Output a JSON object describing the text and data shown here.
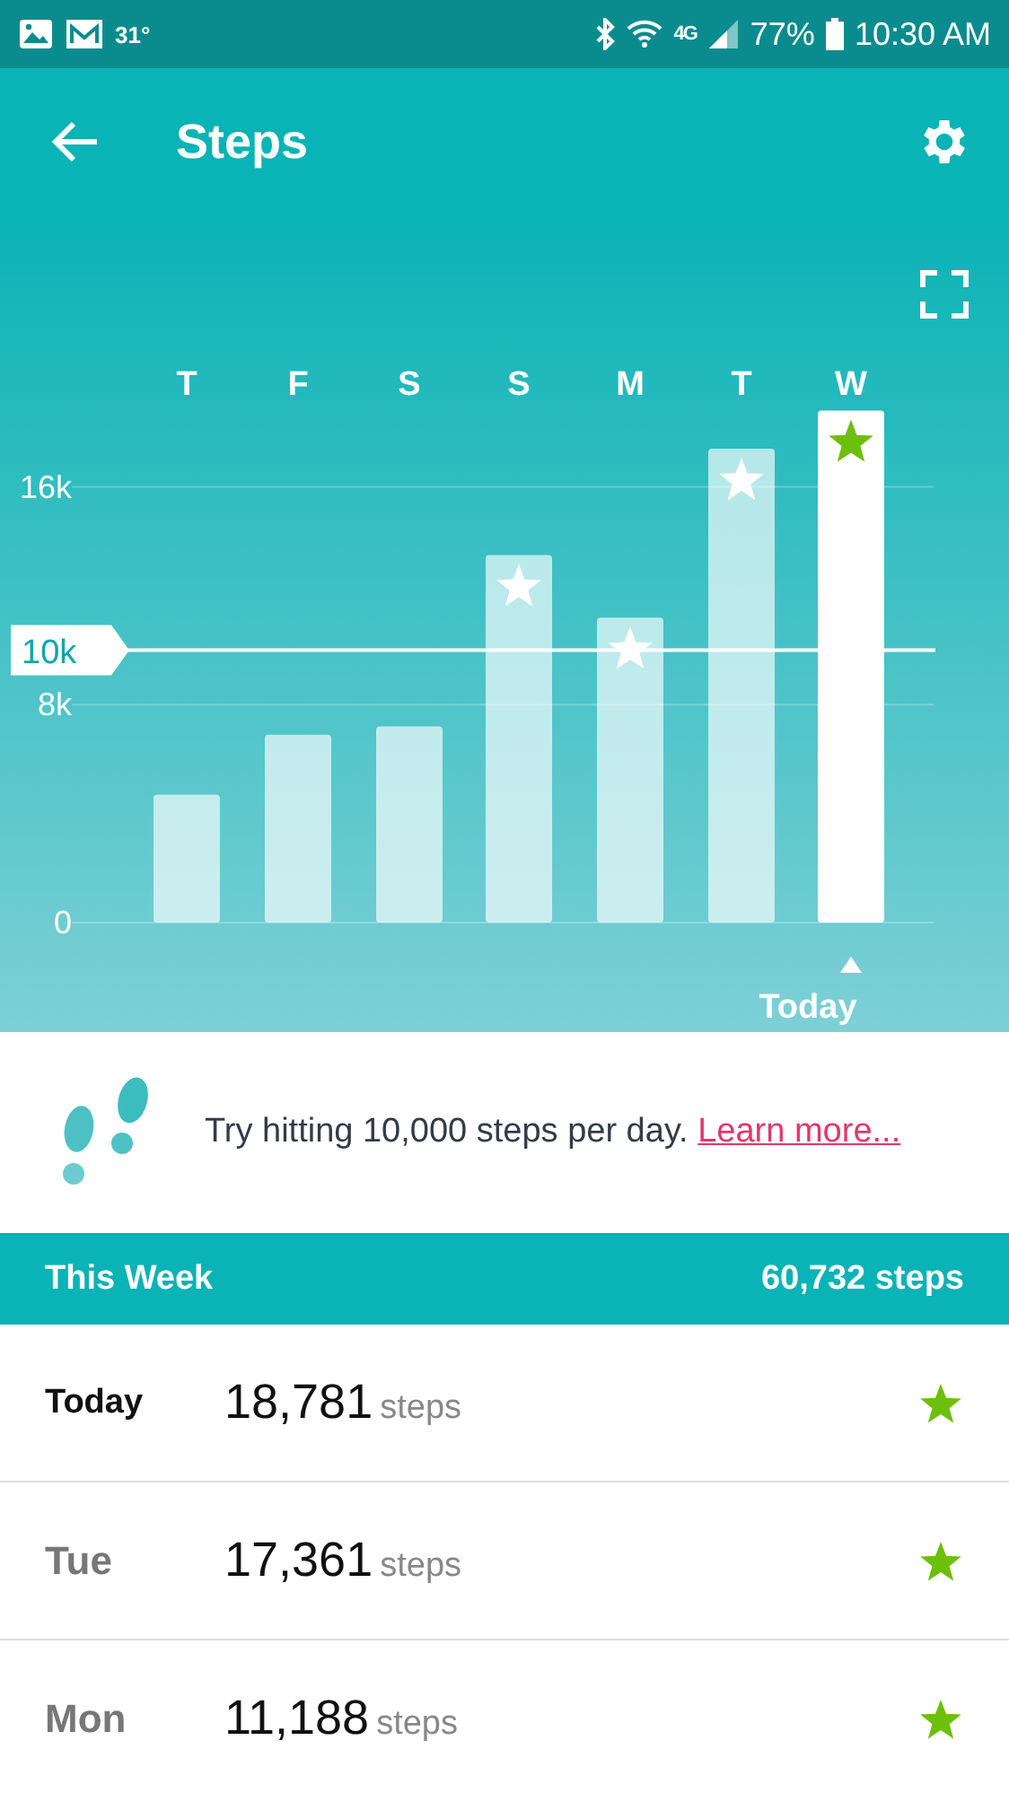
{
  "status_bar": {
    "temperature": "31°",
    "network": "4G",
    "battery": "77%",
    "time": "10:30 AM"
  },
  "header": {
    "title": "Steps"
  },
  "chart": {
    "chart_data": {
      "type": "bar",
      "categories": [
        "T",
        "F",
        "S",
        "S",
        "M",
        "T",
        "W"
      ],
      "values": [
        4700,
        6900,
        7200,
        13500,
        11200,
        17400,
        18800
      ],
      "ylim": [
        0,
        18800
      ],
      "yticks": [
        0,
        {
          "value": 8000,
          "label": "8k"
        },
        {
          "value": 16000,
          "label": "16k"
        }
      ],
      "ref_lines": [
        {
          "axis": "y",
          "value": 10000,
          "label": "10k"
        }
      ]
    },
    "bars": [
      {
        "selected": false
      },
      {
        "selected": false
      },
      {
        "selected": false
      },
      {
        "selected": false
      },
      {
        "selected": false
      },
      {
        "selected": false
      },
      {
        "selected": true
      }
    ],
    "selected_caption": "Today"
  },
  "tip": {
    "text": "Try hitting 10,000 steps per day.",
    "link": "Learn more..."
  },
  "week": {
    "label": "This Week",
    "total": "60,732 steps"
  },
  "days": [
    {
      "day": "Today",
      "current": true,
      "count": "18,781",
      "unit": "steps",
      "goal_met": true
    },
    {
      "day": "Tue",
      "current": false,
      "count": "17,361",
      "unit": "steps",
      "goal_met": true
    },
    {
      "day": "Mon",
      "current": false,
      "count": "11,188",
      "unit": "steps",
      "goal_met": true
    }
  ]
}
